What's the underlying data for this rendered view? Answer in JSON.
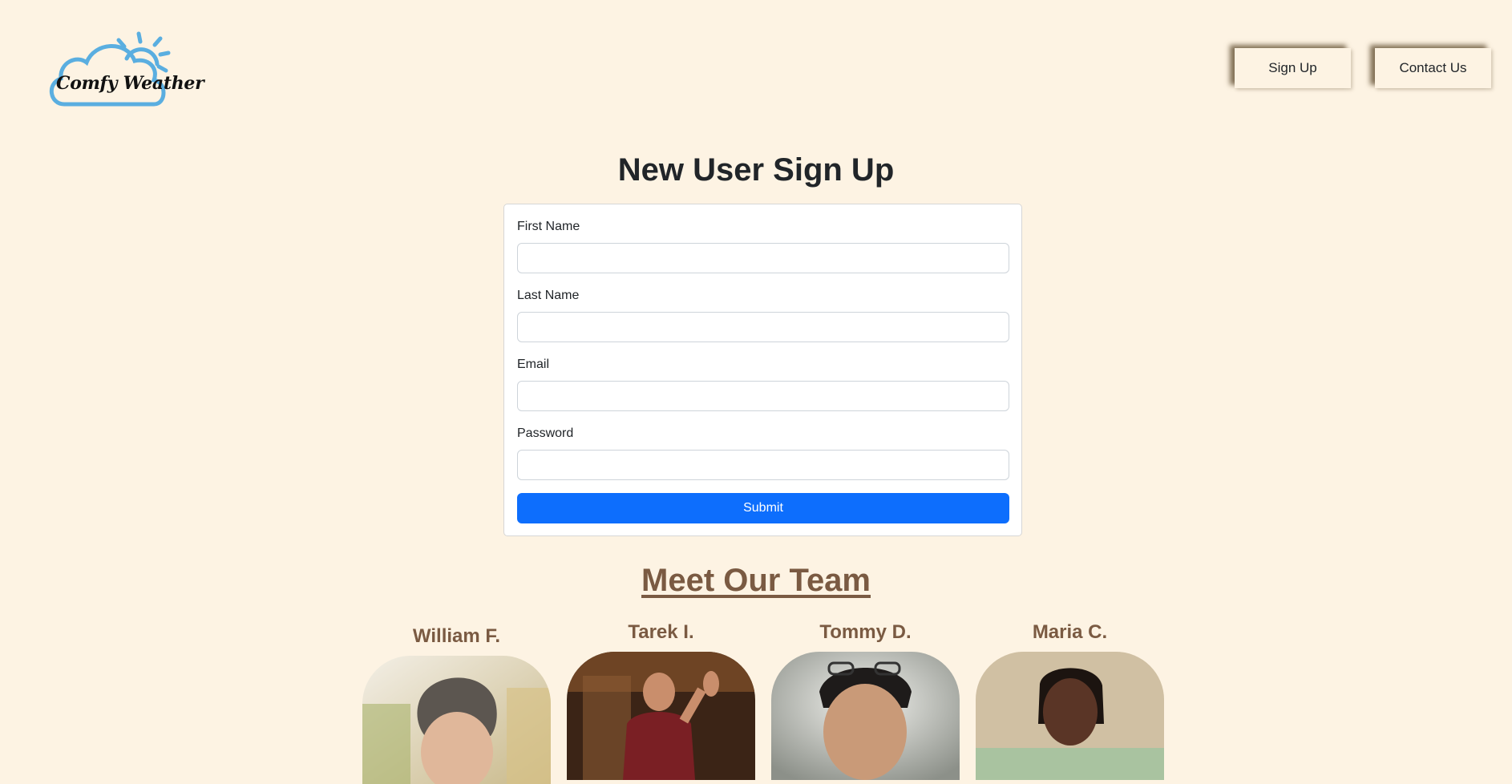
{
  "header": {
    "logo_text": "Comfy Weather",
    "nav": [
      {
        "label": "Sign Up"
      },
      {
        "label": "Contact Us"
      }
    ]
  },
  "signup": {
    "title": "New User Sign Up",
    "fields": [
      {
        "label": "First Name",
        "value": ""
      },
      {
        "label": "Last Name",
        "value": ""
      },
      {
        "label": "Email",
        "value": ""
      },
      {
        "label": "Password",
        "value": ""
      }
    ],
    "submit_label": "Submit"
  },
  "team": {
    "title": "Meet Our Team",
    "members": [
      {
        "name": "William F."
      },
      {
        "name": "Tarek I."
      },
      {
        "name": "Tommy D."
      },
      {
        "name": "Maria C."
      }
    ]
  },
  "colors": {
    "background": "#fdf3e3",
    "accent_brown": "#7a5a42",
    "submit_blue": "#0d6efd",
    "logo_blue": "#5aaee0"
  }
}
